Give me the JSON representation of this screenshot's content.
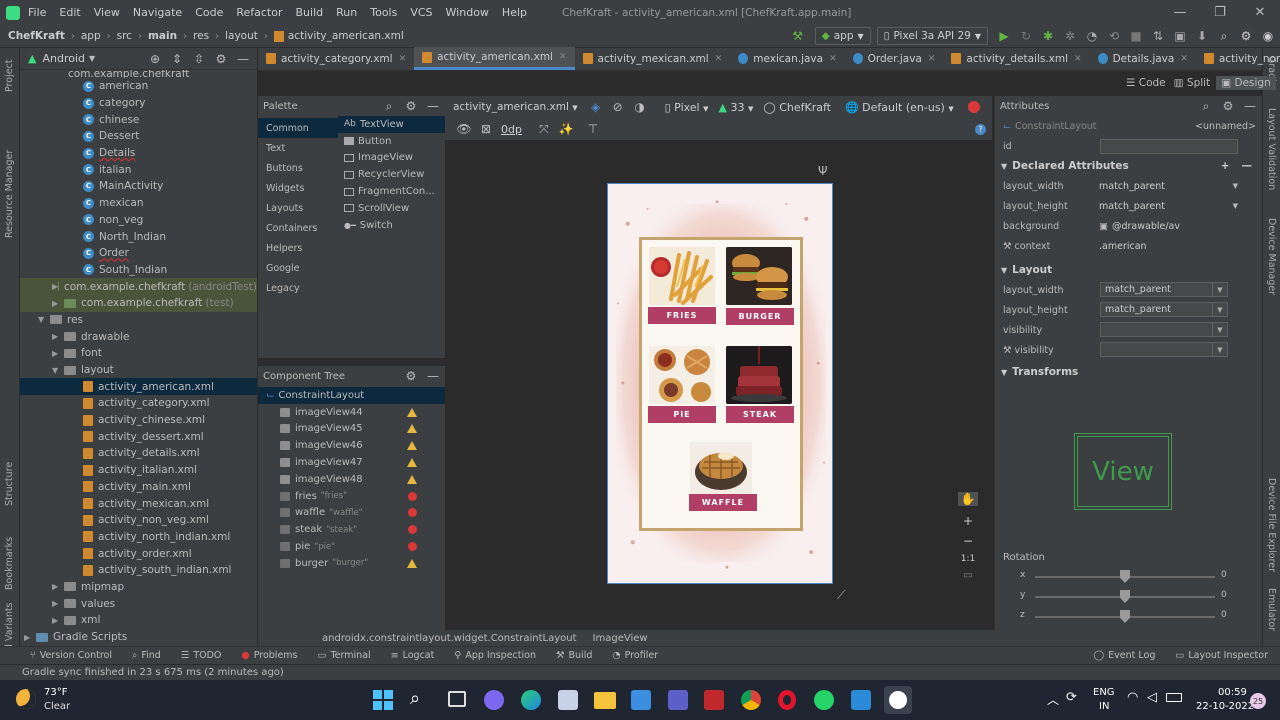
{
  "window": {
    "menus": [
      "File",
      "Edit",
      "View",
      "Navigate",
      "Code",
      "Refactor",
      "Build",
      "Run",
      "Tools",
      "VCS",
      "Window",
      "Help"
    ],
    "title": "ChefKraft - activity_american.xml [ChefKraft.app.main]",
    "controls": [
      "—",
      "❐",
      "✕"
    ]
  },
  "navbar": {
    "breadcrumbs": [
      "ChefKraft",
      "app",
      "src",
      "main",
      "res",
      "layout",
      "activity_american.xml"
    ],
    "run_config": "app",
    "device": "Pixel 3a API 29"
  },
  "side_tools_left": [
    "Project",
    "Resource Manager",
    "Structure",
    "Bookmarks",
    "Build Variants"
  ],
  "side_tools_right": [
    "Gradle",
    "Layout Validation",
    "Device Manager",
    "Device File Explorer",
    "Emulator"
  ],
  "project": {
    "view_mode": "Android",
    "package_header": "com.example.chefkraft",
    "classes": [
      "american",
      "category",
      "chinese",
      "Dessert",
      "Details",
      "italian",
      "MainActivity",
      "mexican",
      "non_veg",
      "North_Indian",
      "Order",
      "South_Indian"
    ],
    "test_packages": [
      {
        "name": "com.example.chefkraft",
        "tag": "(androidTest)"
      },
      {
        "name": "com.example.chefkraft",
        "tag": "(test)"
      }
    ],
    "res": "res",
    "res_folders_top": [
      "drawable",
      "font",
      "layout"
    ],
    "layouts": [
      "activity_american.xml",
      "activity_category.xml",
      "activity_chinese.xml",
      "activity_dessert.xml",
      "activity_details.xml",
      "activity_italian.xml",
      "activity_main.xml",
      "activity_mexican.xml",
      "activity_non_veg.xml",
      "activity_north_indian.xml",
      "activity_order.xml",
      "activity_south_indian.xml"
    ],
    "res_folders_bottom": [
      "mipmap",
      "values",
      "xml"
    ],
    "gradle": "Gradle Scripts"
  },
  "tabs": [
    "activity_category.xml",
    "activity_american.xml",
    "activity_mexican.xml",
    "mexican.java",
    "Order.java",
    "activity_details.xml",
    "Details.java",
    "activity_non_veg.xml"
  ],
  "view_modes": [
    "Code",
    "Split",
    "Design"
  ],
  "palette": {
    "title": "Palette",
    "categories": [
      "Common",
      "Text",
      "Buttons",
      "Widgets",
      "Layouts",
      "Containers",
      "Helpers",
      "Google",
      "Legacy"
    ],
    "items": [
      "TextView",
      "Button",
      "ImageView",
      "RecyclerView",
      "FragmentCon...",
      "ScrollView",
      "Switch"
    ],
    "textview_prefix": "Ab"
  },
  "component_tree": {
    "title": "Component Tree",
    "root": "ConstraintLayout",
    "children": [
      {
        "name": "imageView44",
        "sub": "",
        "status": "warn"
      },
      {
        "name": "imageView45",
        "sub": "",
        "status": "warn"
      },
      {
        "name": "imageView46",
        "sub": "",
        "status": "warn"
      },
      {
        "name": "imageView47",
        "sub": "",
        "status": "warn"
      },
      {
        "name": "imageView48",
        "sub": "",
        "status": "warn"
      },
      {
        "name": "fries",
        "sub": "\"fries\"",
        "status": "error"
      },
      {
        "name": "waffle",
        "sub": "\"waffle\"",
        "status": "error"
      },
      {
        "name": "steak",
        "sub": "\"steak\"",
        "status": "error"
      },
      {
        "name": "pie",
        "sub": "\"pie\"",
        "status": "error"
      },
      {
        "name": "burger",
        "sub": "\"burger\"",
        "status": "warn"
      }
    ]
  },
  "design_toolbar": {
    "file": "activity_american.xml",
    "device": "Pixel",
    "api": "33",
    "theme": "ChefKraft",
    "locale": "Default (en-us)",
    "margin": "0dp"
  },
  "preview": {
    "labels": [
      "FRIES",
      "BURGER",
      "PIE",
      "STEAK",
      "WAFFLE"
    ]
  },
  "zoom_controls": [
    "+",
    "−",
    "1:1"
  ],
  "attributes": {
    "title": "Attributes",
    "component": "ConstraintLayout",
    "component_id": "<unnamed>",
    "id_label": "id",
    "declared_title": "Declared Attributes",
    "declared": [
      {
        "k": "layout_width",
        "v": "match_parent"
      },
      {
        "k": "layout_height",
        "v": "match_parent"
      },
      {
        "k": "background",
        "v": "@drawable/av"
      },
      {
        "k": "context",
        "v": ".american"
      }
    ],
    "layout_title": "Layout",
    "layout": [
      {
        "k": "layout_width",
        "v": "match_parent"
      },
      {
        "k": "layout_height",
        "v": "match_parent"
      },
      {
        "k": "visibility",
        "v": ""
      },
      {
        "k": "visibility",
        "v": ""
      }
    ],
    "transforms_title": "Transforms",
    "view_label": "View",
    "rotation_title": "Rotation",
    "rotation": [
      {
        "axis": "x",
        "value": "0"
      },
      {
        "axis": "y",
        "value": "0"
      },
      {
        "axis": "z",
        "value": "0"
      }
    ]
  },
  "path_bar": [
    "androidx.constraintlayout.widget.ConstraintLayout",
    "ImageView"
  ],
  "tool_windows": [
    "Version Control",
    "Find",
    "TODO",
    "Problems",
    "Terminal",
    "Logcat",
    "App Inspection",
    "Build",
    "Profiler"
  ],
  "tool_windows_right": [
    "Event Log",
    "Layout Inspector"
  ],
  "status": "Gradle sync finished in 23 s 675 ms (2 minutes ago)",
  "taskbar": {
    "temp": "73°F",
    "weather": "Clear",
    "lang": "ENG",
    "region": "IN",
    "time": "00:59",
    "date": "22-10-2022",
    "badge": "25"
  },
  "colors": {
    "accent": "#4a88c7",
    "label_bg": "#b13e65",
    "frame": "#c4a46d",
    "panel": "#3c3f41",
    "bg": "#2b2b2b"
  }
}
